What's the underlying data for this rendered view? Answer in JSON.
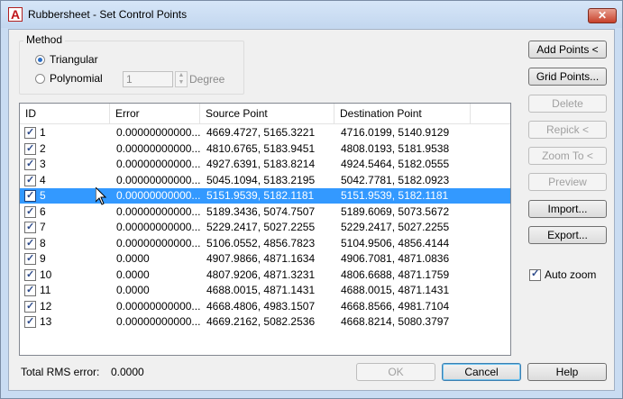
{
  "window": {
    "title": "Rubbersheet - Set Control Points",
    "close_label": "✕"
  },
  "method": {
    "legend": "Method",
    "triangular_label": "Triangular",
    "polynomial_label": "Polynomial",
    "degree_value": "1",
    "degree_label": "Degree",
    "selected": "Triangular"
  },
  "table": {
    "headers": {
      "id": "ID",
      "error": "Error",
      "source": "Source Point",
      "destination": "Destination Point"
    },
    "rows": [
      {
        "checked": true,
        "id": "1",
        "error": "0.00000000000...",
        "source": "4669.4727, 5165.3221",
        "destination": "4716.0199, 5140.9129"
      },
      {
        "checked": true,
        "id": "2",
        "error": "0.00000000000...",
        "source": "4810.6765, 5183.9451",
        "destination": "4808.0193, 5181.9538"
      },
      {
        "checked": true,
        "id": "3",
        "error": "0.00000000000...",
        "source": "4927.6391, 5183.8214",
        "destination": "4924.5464, 5182.0555"
      },
      {
        "checked": true,
        "id": "4",
        "error": "0.00000000000...",
        "source": "5045.1094, 5183.2195",
        "destination": "5042.7781, 5182.0923"
      },
      {
        "checked": true,
        "id": "5",
        "error": "0.00000000000...",
        "source": "5151.9539, 5182.1181",
        "destination": "5151.9539, 5182.1181",
        "selected": true
      },
      {
        "checked": true,
        "id": "6",
        "error": "0.00000000000...",
        "source": "5189.3436, 5074.7507",
        "destination": "5189.6069, 5073.5672"
      },
      {
        "checked": true,
        "id": "7",
        "error": "0.00000000000...",
        "source": "5229.2417, 5027.2255",
        "destination": "5229.2417, 5027.2255"
      },
      {
        "checked": true,
        "id": "8",
        "error": "0.00000000000...",
        "source": "5106.0552, 4856.7823",
        "destination": "5104.9506, 4856.4144"
      },
      {
        "checked": true,
        "id": "9",
        "error": "0.0000",
        "source": "4907.9866, 4871.1634",
        "destination": "4906.7081, 4871.0836"
      },
      {
        "checked": true,
        "id": "10",
        "error": "0.0000",
        "source": "4807.9206, 4871.3231",
        "destination": "4806.6688, 4871.1759"
      },
      {
        "checked": true,
        "id": "11",
        "error": "0.0000",
        "source": "4688.0015, 4871.1431",
        "destination": "4688.0015, 4871.1431"
      },
      {
        "checked": true,
        "id": "12",
        "error": "0.00000000000...",
        "source": "4668.4806, 4983.1507",
        "destination": "4668.8566, 4981.7104"
      },
      {
        "checked": true,
        "id": "13",
        "error": "0.00000000000...",
        "source": "4669.2162, 5082.2536",
        "destination": "4668.8214, 5080.3797"
      }
    ]
  },
  "side_buttons": {
    "add_points": "Add Points <",
    "grid_points": "Grid Points...",
    "delete": "Delete",
    "repick": "Repick <",
    "zoom_to": "Zoom To <",
    "preview": "Preview",
    "import": "Import...",
    "export": "Export..."
  },
  "auto_zoom": {
    "label": "Auto zoom",
    "checked": true
  },
  "rms": {
    "label": "Total RMS error:",
    "value": "0.0000"
  },
  "bottom_buttons": {
    "ok": "OK",
    "cancel": "Cancel",
    "help": "Help"
  },
  "colors": {
    "selection": "#3399ff",
    "brand_red": "#c0151b"
  }
}
